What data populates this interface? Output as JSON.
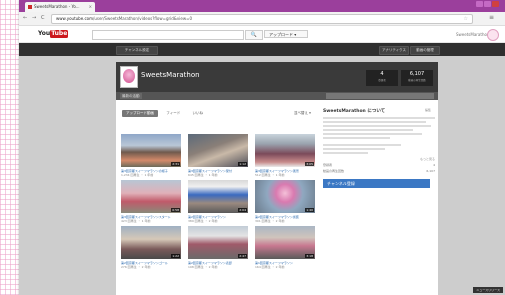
{
  "browser": {
    "tab_title": "SweetsMarathon - Yo...",
    "tab_close": "×",
    "url_prefix": "www.youtube.com",
    "url_rest": "/user/SweetsMarathon/videos?flow=grid&view=0",
    "nav": {
      "back": "←",
      "forward": "→",
      "reload": "C"
    }
  },
  "masthead": {
    "logo_you": "You",
    "logo_tube": "Tube",
    "search_button": "🔍",
    "upload_label": "アップロード ▾",
    "account_name": "SweetsMarathon"
  },
  "guide": {
    "left_button": "チャンネル設定",
    "right_button_1": "アナリティクス",
    "right_button_2": "動画の管理"
  },
  "channel": {
    "name": "SweetsMarathon",
    "stats": [
      {
        "value": "4",
        "label": "登録者"
      },
      {
        "value": "6,107",
        "label": "動画の再生回数"
      }
    ],
    "tab": "最新の活動"
  },
  "video_tabs": [
    "アップロード動画",
    "フィード",
    "いいね"
  ],
  "active_video_tab": 0,
  "sort_label": "並べ替え ▾",
  "videos": [
    {
      "title": "第3回京都スイーツマラソンの様子",
      "meta": "1,234 回再生 ・ 1 年前",
      "dur": "2:31"
    },
    {
      "title": "第3回京都スイーツマラソン受付",
      "meta": "645 回再生 ・ 1 年前",
      "dur": "1:12"
    },
    {
      "title": "第3回京都スイーツマラソン風景",
      "meta": "512 回再生 ・ 1 年前",
      "dur": "3:05"
    },
    {
      "title": "第3回京都スイーツマラソンスタート",
      "meta": "423 回再生 ・ 1 年前",
      "dur": "0:58"
    },
    {
      "title": "第2回京都スイーツマラソン",
      "meta": "389 回再生 ・ 2 年前",
      "dur": "2:04"
    },
    {
      "title": "第2回京都スイーツマラソン仮装",
      "meta": "301 回再生 ・ 2 年前",
      "dur": "1:40"
    },
    {
      "title": "第2回京都スイーツマラソンゴール",
      "meta": "276 回再生 ・ 2 年前",
      "dur": "1:22"
    },
    {
      "title": "第2回京都スイーツマラソン表彰",
      "meta": "198 回再生 ・ 2 年前",
      "dur": "2:47"
    },
    {
      "title": "第1回京都スイーツマラソン",
      "meta": "164 回再生 ・ 2 年前",
      "dur": "3:18"
    }
  ],
  "sidebar": {
    "title": "SweetsMarathon について",
    "edit": "編集",
    "more": "もっと見る",
    "stats": [
      {
        "k": "登録者",
        "v": "4"
      },
      {
        "k": "動画の再生回数",
        "v": "6,107"
      }
    ],
    "subscribe": "チャンネル登録"
  },
  "overlay_text": "ニュースリリース"
}
